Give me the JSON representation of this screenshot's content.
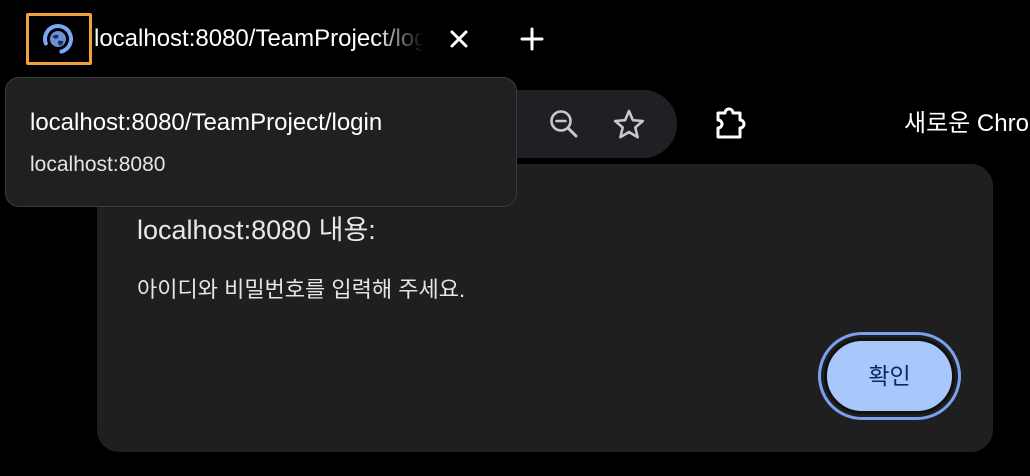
{
  "tab": {
    "title": "localhost:8080/TeamProject/login",
    "favicon": "globe-loading-icon",
    "close_icon": "close-icon",
    "new_tab_icon": "plus-icon"
  },
  "toolbar": {
    "icons": [
      "zoom-out-icon",
      "star-icon",
      "extension-icon"
    ],
    "profile_label": "새로운 Chro"
  },
  "hover_card": {
    "title": "localhost:8080/TeamProject/login",
    "domain": "localhost:8080"
  },
  "dialog": {
    "title": "localhost:8080 내용:",
    "message": "아이디와 비밀번호를 입력해 주세요.",
    "ok_label": "확인"
  },
  "colors": {
    "background": "#000000",
    "dialog_bg": "#1f1f1f",
    "button_bg": "#a8c7fa",
    "button_text": "#0b2a5c",
    "focus_ring": "#7aa0f0",
    "favicon_highlight": "#f2a23a"
  }
}
